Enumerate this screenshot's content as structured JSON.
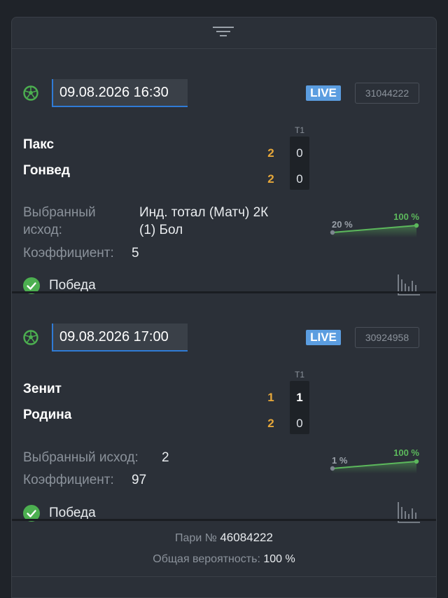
{
  "bets": [
    {
      "date": "09.08.2026 16:30",
      "live": "LIVE",
      "event_id": "31044222",
      "period_header": "Т1",
      "teams": [
        {
          "name": "Пакс",
          "score": "2",
          "period": "0"
        },
        {
          "name": "Гонвед",
          "score": "2",
          "period": "0"
        }
      ],
      "outcome_label_1": "Выбранный",
      "outcome_label_2": "исход:",
      "outcome_value_1": "Инд. тотал (Матч) 2К",
      "outcome_value_2": "(1) Бол",
      "coef_label": "Коэффициент:",
      "coef_value": "5",
      "result": "Победа",
      "prob_start": "20 %",
      "prob_end": "100 %",
      "prob_start_value": 20,
      "prob_end_value": 100
    },
    {
      "date": "09.08.2026 17:00",
      "live": "LIVE",
      "event_id": "30924958",
      "period_header": "Т1",
      "teams": [
        {
          "name": "Зенит",
          "score": "1",
          "period": "1"
        },
        {
          "name": "Родина",
          "score": "2",
          "period": "0"
        }
      ],
      "outcome_label": "Выбранный исход:",
      "outcome_value": "2",
      "coef_label": "Коэффициент:",
      "coef_value": "97",
      "result": "Победа",
      "prob_start": "1 %",
      "prob_end": "100 %",
      "prob_start_value": 1,
      "prob_end_value": 100
    }
  ],
  "footer": {
    "pari_label": "Пари №",
    "pari_value": "46084222",
    "prob_label": "Общая вероятность:",
    "prob_value": "100 %"
  },
  "colors": {
    "accent": "#2f7bd6",
    "live": "#5b9de0",
    "score": "#e6a73a",
    "win": "#4caf50",
    "spark": "#5cb85c"
  },
  "icons": {
    "handle": "menu-lines-icon",
    "sport": "soccer-ball-icon",
    "win": "check-circle-icon",
    "stats": "bar-chart-icon"
  }
}
